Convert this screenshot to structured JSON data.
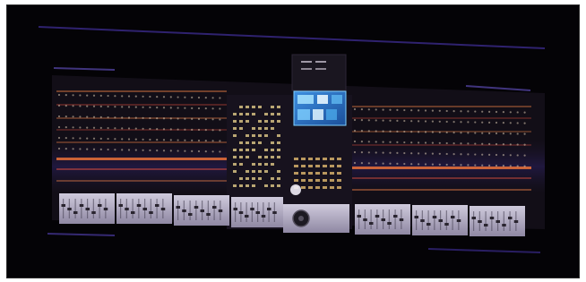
{
  "image": {
    "subject": "mixing-console",
    "colors": {
      "background": "#040306",
      "console_body": "#141018",
      "led_orange": "#ff8a4a",
      "led_red": "#e05040",
      "led_amber": "#ffcc70",
      "screen_blue": "#2f78c8",
      "screen_cyan": "#7fd0ff",
      "purple_trim": "#3a2a8a",
      "fader_panel": "#b7b2c6"
    }
  }
}
